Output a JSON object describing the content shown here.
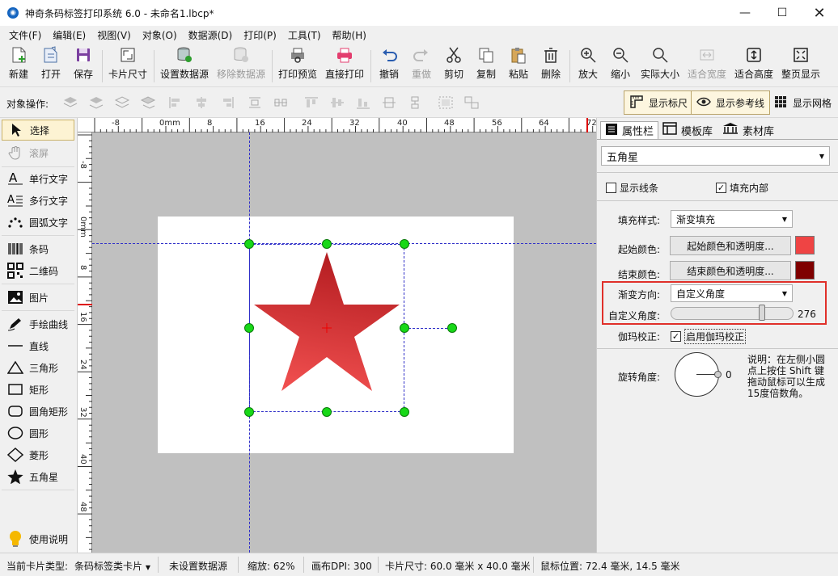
{
  "window": {
    "title": "神奇条码标签打印系统 6.0 - 未命名1.lbcp*"
  },
  "menu": [
    "文件(F)",
    "编辑(E)",
    "视图(V)",
    "对象(O)",
    "数据源(D)",
    "打印(P)",
    "工具(T)",
    "帮助(H)"
  ],
  "toolbar": {
    "new": "新建",
    "open": "打开",
    "save": "保存",
    "card_size": "卡片尺寸",
    "set_datasource": "设置数据源",
    "remove_datasource": "移除数据源",
    "print_preview": "打印预览",
    "direct_print": "直接打印",
    "undo": "撤销",
    "redo": "重做",
    "cut": "剪切",
    "copy": "复制",
    "paste": "粘贴",
    "delete": "删除",
    "zoom_in": "放大",
    "zoom_out": "缩小",
    "actual_size": "实际大小",
    "fit_width": "适合宽度",
    "fit_height": "适合高度",
    "fit_page": "整页显示"
  },
  "objbar": {
    "label": "对象操作:",
    "show_ruler": "显示标尺",
    "show_guides": "显示参考线",
    "show_grid": "显示网格"
  },
  "tools": {
    "select": "选择",
    "scroll": "滚屏",
    "single_text": "单行文字",
    "multi_text": "多行文字",
    "arc_text": "圆弧文字",
    "barcode": "条码",
    "qrcode": "二维码",
    "image": "图片",
    "freehand": "手绘曲线",
    "line": "直线",
    "triangle": "三角形",
    "rect": "矩形",
    "round_rect": "圆角矩形",
    "ellipse": "圆形",
    "diamond": "菱形",
    "star": "五角星",
    "help": "使用说明"
  },
  "ruler": {
    "h_labels": [
      "-8",
      "0mm",
      "8",
      "16",
      "24",
      "32",
      "40",
      "48",
      "56",
      "64",
      "72"
    ],
    "v_labels": [
      "-8",
      "0mm",
      "8",
      "16",
      "24",
      "32",
      "40",
      "48"
    ]
  },
  "panel": {
    "tabs": [
      "属性栏",
      "模板库",
      "素材库"
    ],
    "object_type": "五角星",
    "show_border": "显示线条",
    "fill_inside": "填充内部",
    "fill_style_label": "填充样式:",
    "fill_style_value": "渐变填充",
    "start_color_label": "起始颜色:",
    "start_color_btn": "起始颜色和透明度...",
    "end_color_label": "结束颜色:",
    "end_color_btn": "结束颜色和透明度...",
    "gradient_dir_label": "渐变方向:",
    "gradient_dir_value": "自定义角度",
    "custom_angle_label": "自定义角度:",
    "custom_angle_value": "276",
    "gamma_label": "伽玛校正:",
    "gamma_check": "启用伽玛校正",
    "rotate_label": "旋转角度:",
    "rotate_value": "0",
    "note": "说明：在左侧小圆点上按住 Shift 键拖动鼠标可以生成15度倍数角。"
  },
  "colors": {
    "start": "#ef4444",
    "end": "#7f0000",
    "accent_box": "#e0302a",
    "handle": "#18d818",
    "guide": "#3030c8"
  },
  "status": {
    "card_type_label": "当前卡片类型:",
    "card_type": "条码标签类卡片",
    "datasource": "未设置数据源",
    "zoom": "缩放: 62%",
    "dpi": "画布DPI: 300",
    "card_size": "卡片尺寸: 60.0 毫米 x 40.0 毫米",
    "mouse_pos": "鼠标位置: 72.4 毫米, 14.5 毫米"
  }
}
